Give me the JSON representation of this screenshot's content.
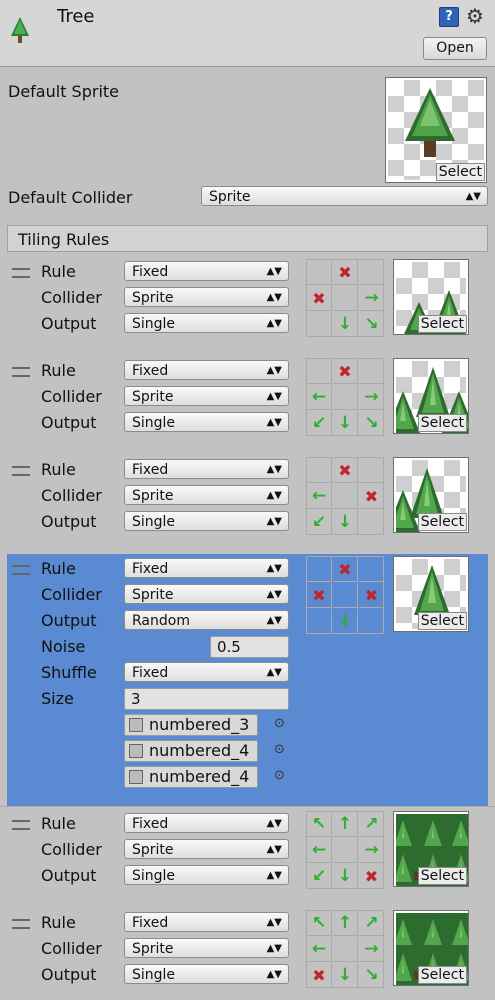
{
  "header": {
    "title": "Tree",
    "open_label": "Open",
    "help_icon": "help-icon",
    "gear_icon": "gear-icon"
  },
  "default_sprite": {
    "label": "Default Sprite",
    "select_label": "Select"
  },
  "default_collider": {
    "label": "Default Collider",
    "value": "Sprite"
  },
  "tiling_rules": {
    "title": "Tiling Rules",
    "row_labels": {
      "rule": "Rule",
      "collider": "Collider",
      "output": "Output",
      "noise": "Noise",
      "shuffle": "Shuffle",
      "size": "Size"
    },
    "select_label": "Select",
    "rules": [
      {
        "rule": "Fixed",
        "collider": "Sprite",
        "output": "Single",
        "neighbors": [
          "",
          "x",
          "",
          "x",
          "",
          "right",
          "",
          "down",
          "down-right"
        ]
      },
      {
        "rule": "Fixed",
        "collider": "Sprite",
        "output": "Single",
        "neighbors": [
          "",
          "x",
          "",
          "left",
          "",
          "right",
          "down-left",
          "down",
          "down-right"
        ]
      },
      {
        "rule": "Fixed",
        "collider": "Sprite",
        "output": "Single",
        "neighbors": [
          "",
          "x",
          "",
          "left",
          "",
          "x",
          "down-left",
          "down",
          ""
        ]
      },
      {
        "rule": "Fixed",
        "collider": "Sprite",
        "output": "Random",
        "noise": "0.5",
        "shuffle": "Fixed",
        "size": "3",
        "sprites": [
          "numbered_3",
          "numbered_4",
          "numbered_4"
        ],
        "neighbors": [
          "",
          "x",
          "",
          "x",
          "",
          "x",
          "",
          "down",
          ""
        ]
      },
      {
        "rule": "Fixed",
        "collider": "Sprite",
        "output": "Single",
        "neighbors": [
          "up-left",
          "up",
          "up-right",
          "left",
          "",
          "right",
          "down-left",
          "down",
          "x"
        ]
      },
      {
        "rule": "Fixed",
        "collider": "Sprite",
        "output": "Single",
        "neighbors": [
          "up-left",
          "up",
          "up-right",
          "left",
          "",
          "right",
          "x",
          "down",
          "down-right"
        ]
      }
    ]
  }
}
